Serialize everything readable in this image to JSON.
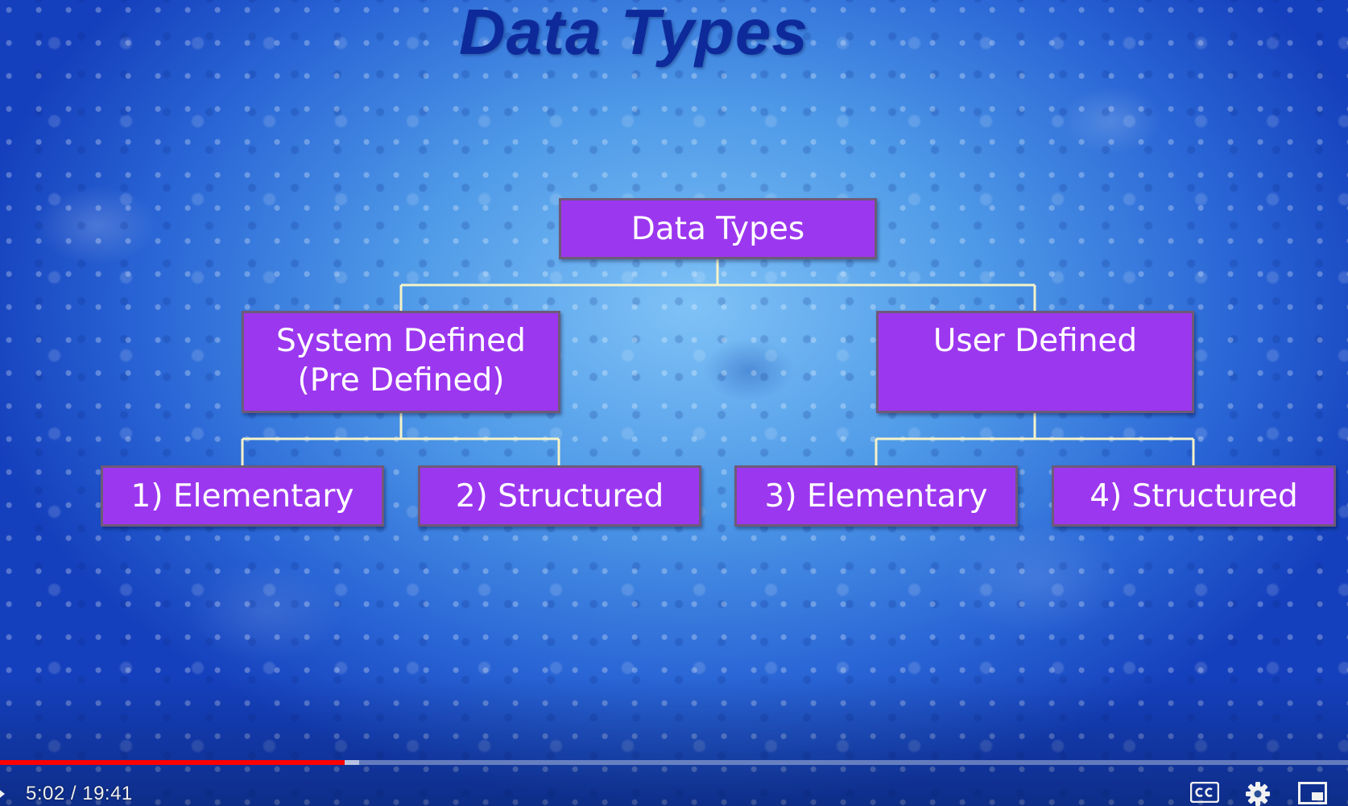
{
  "slide": {
    "title": "Data Types"
  },
  "diagram": {
    "root": "Data Types",
    "system_defined": [
      "System Defined",
      "(Pre Defined)"
    ],
    "user_defined": "User Defined",
    "leaves": [
      "1) Elementary",
      "2) Structured",
      "3) Elementary",
      "4) Structured"
    ]
  },
  "player": {
    "current_time": "5:02",
    "duration": "19:41",
    "time_display": "5:02 / 19:41",
    "progress_fraction": 0.2557,
    "buffered_fraction": 0.217,
    "accent_color": "#ff0000",
    "icons": [
      "play-icon",
      "closed-captions-icon",
      "settings-gear-icon",
      "miniplayer-icon"
    ]
  },
  "colors": {
    "node_fill": "#9c37f0",
    "connector": "#f5f3c8",
    "title": "#0e2a9a"
  }
}
